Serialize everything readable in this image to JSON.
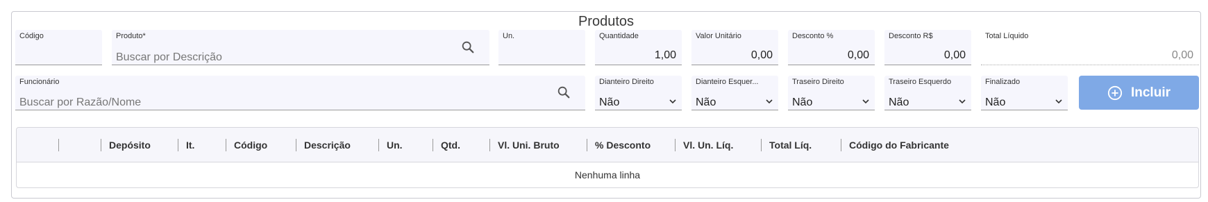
{
  "section": {
    "title": "Produtos"
  },
  "fields": {
    "codigo": {
      "label": "Código",
      "value": ""
    },
    "produto": {
      "label": "Produto*",
      "placeholder": "Buscar por Descrição"
    },
    "un": {
      "label": "Un.",
      "value": ""
    },
    "quantidade": {
      "label": "Quantidade",
      "value": "1,00"
    },
    "valor_unitario": {
      "label": "Valor Unitário",
      "value": "0,00"
    },
    "desconto_pct": {
      "label": "Desconto %",
      "value": "0,00"
    },
    "desconto_rs": {
      "label": "Desconto R$",
      "value": "0,00"
    },
    "total_liquido": {
      "label": "Total Líquido",
      "value": "0,00"
    },
    "funcionario": {
      "label": "Funcionário",
      "placeholder": "Buscar por Razão/Nome"
    },
    "dianteiro_direito": {
      "label": "Dianteiro Direito",
      "value": "Não"
    },
    "dianteiro_esquerdo": {
      "label": "Dianteiro Esquer...",
      "value": "Não"
    },
    "traseiro_direito": {
      "label": "Traseiro Direito",
      "value": "Não"
    },
    "traseiro_esquerdo": {
      "label": "Traseiro Esquerdo",
      "value": "Não"
    },
    "finalizado": {
      "label": "Finalizado",
      "value": "Não"
    }
  },
  "actions": {
    "incluir_label": "Incluir"
  },
  "table": {
    "columns": [
      "Depósito",
      "It.",
      "Código",
      "Descrição",
      "Un.",
      "Qtd.",
      "Vl. Uni. Bruto",
      "% Desconto",
      "Vl. Un. Líq.",
      "Total Líq.",
      "Código do Fabricante"
    ],
    "empty_message": "Nenhuma linha"
  },
  "icons": {
    "search": "search-icon",
    "chevron": "chevron-down-icon",
    "add": "plus-circle-icon"
  },
  "colors": {
    "primary_button": "#7fa9e6",
    "field_background": "#f6f6fd"
  }
}
